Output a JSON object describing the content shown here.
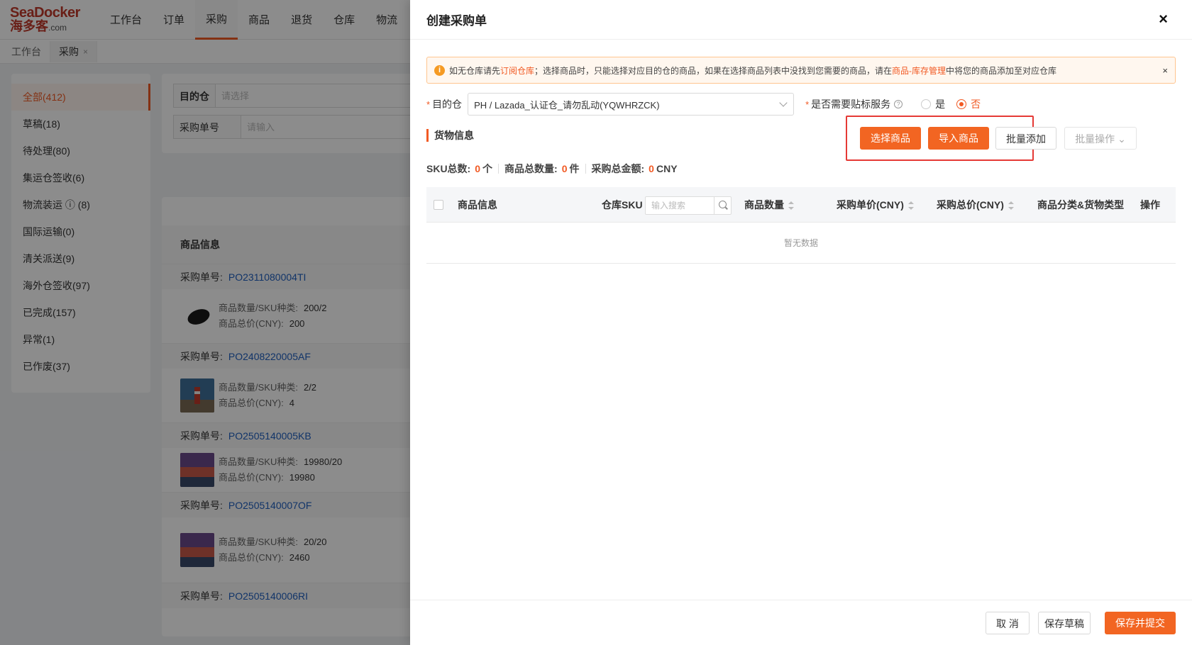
{
  "nav": {
    "logo_top": "SeaDocker",
    "logo_cn": "海多客",
    "logo_dom": ".com",
    "items": [
      "工作台",
      "订单",
      "采购",
      "商品",
      "退货",
      "仓库",
      "物流"
    ]
  },
  "tabs": [
    {
      "label": "工作台"
    },
    {
      "label": "采购",
      "close": "×"
    }
  ],
  "status_menu": [
    "全部(412)",
    "草稿(18)",
    "待处理(80)",
    "集运仓签收(6)",
    "物流装运 ⓘ (8)",
    "国际运输(0)",
    "清关派送(9)",
    "海外仓签收(97)",
    "已完成(157)",
    "异常(1)",
    "已作废(37)"
  ],
  "filters": {
    "dest_label": "目的仓",
    "dest_placeholder": "请选择",
    "po_label": "采购单号",
    "po_placeholder": "请输入"
  },
  "list": {
    "header": "商品信息",
    "po_label": "采购单号:",
    "qty_label": "商品数量/SKU种类:",
    "total_label": "商品总价(CNY):",
    "orders": [
      {
        "po": "PO2311080004TI",
        "qty": "200/2",
        "total": "200"
      },
      {
        "po": "PO2408220005AF",
        "qty": "2/2",
        "total": "4"
      },
      {
        "po": "PO2505140005KB",
        "qty": "19980/20",
        "total": "19980"
      },
      {
        "po": "PO2505140007OF",
        "qty": "20/20",
        "total": "2460"
      },
      {
        "po": "PO2505140006RI"
      }
    ]
  },
  "drawer": {
    "title": "创建采购单",
    "close": "×",
    "notice": {
      "t1": "如无仓库请先 ",
      "link1": "订阅仓库",
      "t2": "；选择商品时，只能选择对应目的仓的商品，如果在选择商品列表中没找到您需要的商品，请在 ",
      "link2": "商品-库存管理",
      "t3": " 中将您的商品添加至对应仓库",
      "close": "×"
    },
    "dest_label": "目的仓",
    "dest_value": "PH / Lazada_认证仓_请勿乱动(YQWHRZCK)",
    "label_service": "是否需要贴标服务",
    "radio_yes": "是",
    "radio_no": "否",
    "section": "货物信息",
    "btn_select": "选择商品",
    "btn_import": "导入商品",
    "btn_batch_add": "批量添加",
    "btn_batch_ops": "批量操作",
    "summary": {
      "sku_label": "SKU总数:",
      "sku_value": "0",
      "sku_unit": "个",
      "qty_label": "商品总数量:",
      "qty_value": "0",
      "qty_unit": "件",
      "amt_label": "采购总金额:",
      "amt_value": "0",
      "amt_unit": "CNY"
    },
    "columns": {
      "info": "商品信息",
      "sku": "仓库SKU",
      "search_placeholder": "输入搜索",
      "qty": "商品数量",
      "unit_price": "采购单价(CNY)",
      "total_price": "采购总价(CNY)",
      "category": "商品分类&货物类型",
      "ops": "操作"
    },
    "empty": "暂无数据",
    "btn_cancel": "取 消",
    "btn_draft": "保存草稿",
    "btn_submit": "保存并提交"
  },
  "colors": {
    "accent": "#f26522",
    "link": "#1f5fbf",
    "highlight_box": "#e53935"
  }
}
